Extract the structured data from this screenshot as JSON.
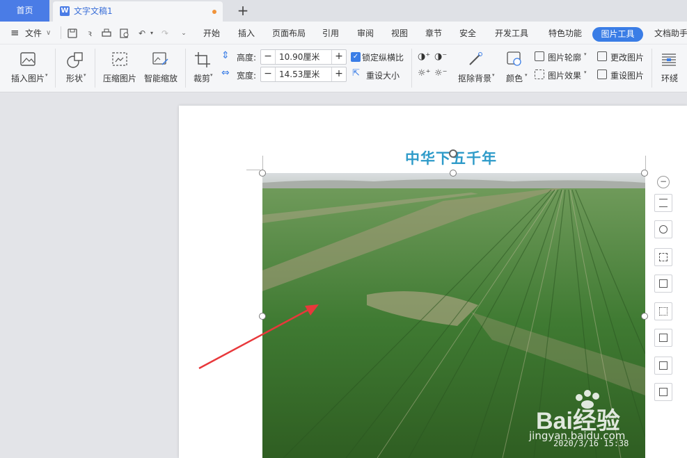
{
  "tabs": {
    "home": "首页",
    "document": "文字文稿1",
    "new_tab": "+"
  },
  "menu": {
    "file": "文件",
    "items": [
      "开始",
      "插入",
      "页面布局",
      "引用",
      "审阅",
      "视图",
      "章节",
      "安全",
      "开发工具",
      "特色功能",
      "图片工具",
      "文档助手"
    ],
    "active": "图片工具"
  },
  "ribbon": {
    "insert_picture": "插入图片",
    "shape": "形状",
    "compress": "压缩图片",
    "smart_zoom": "智能缩放",
    "crop": "裁剪",
    "height_label": "高度:",
    "height_value": "10.90厘米",
    "width_label": "宽度:",
    "width_value": "14.53厘米",
    "lock_ratio": "锁定纵横比",
    "reset_size": "重设大小",
    "remove_bg": "抠除背景",
    "color": "颜色",
    "outline": "图片轮廓",
    "effects": "图片效果",
    "change_pic": "更改图片",
    "reset_pic": "重设图片",
    "wrap": "环绕"
  },
  "document": {
    "heading": "中华下五千年"
  },
  "photo": {
    "watermark_brand": "Bai经验",
    "watermark_url": "jingyan.baidu.com",
    "date_stamp": "2020/3/16  15:38"
  },
  "colors": {
    "accent": "#3a7de6",
    "heading": "#2e9bc9",
    "arrow": "#e8383b",
    "modified_dot": "#f0933a"
  }
}
